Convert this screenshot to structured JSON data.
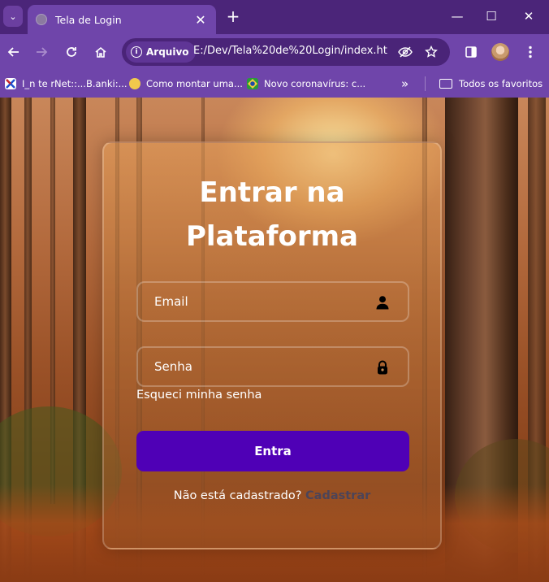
{
  "browser": {
    "tab_title": "Tela de Login",
    "tab_close": "✕",
    "new_tab": "+",
    "minimize": "—",
    "maximize": "☐",
    "close": "✕",
    "site_info_label": "Arquivo",
    "url": "E:/Dev/Tela%20de%20Login/index.ht...",
    "bookmarks": [
      {
        "label": "I_n te rNet::...B.anki:..."
      },
      {
        "label": "Como montar uma..."
      },
      {
        "label": "Novo coronavírus: c..."
      }
    ],
    "more_bookmarks": "»",
    "all_bookmarks": "Todos os favoritos"
  },
  "login": {
    "title_line1": "Entrar na",
    "title_line2": "Plataforma",
    "email_placeholder": "Email",
    "password_placeholder": "Senha",
    "forgot_password": "Esqueci minha senha",
    "submit_label": "Entra",
    "register_prompt": "Não está cadastrado?",
    "register_link": "Cadastrar"
  },
  "colors": {
    "chrome_accent": "#6f45aa",
    "submit_button": "#4f00b6",
    "register_link": "#4c4458"
  },
  "icons": {
    "email_field": "user-icon",
    "password_field": "lock-icon"
  }
}
